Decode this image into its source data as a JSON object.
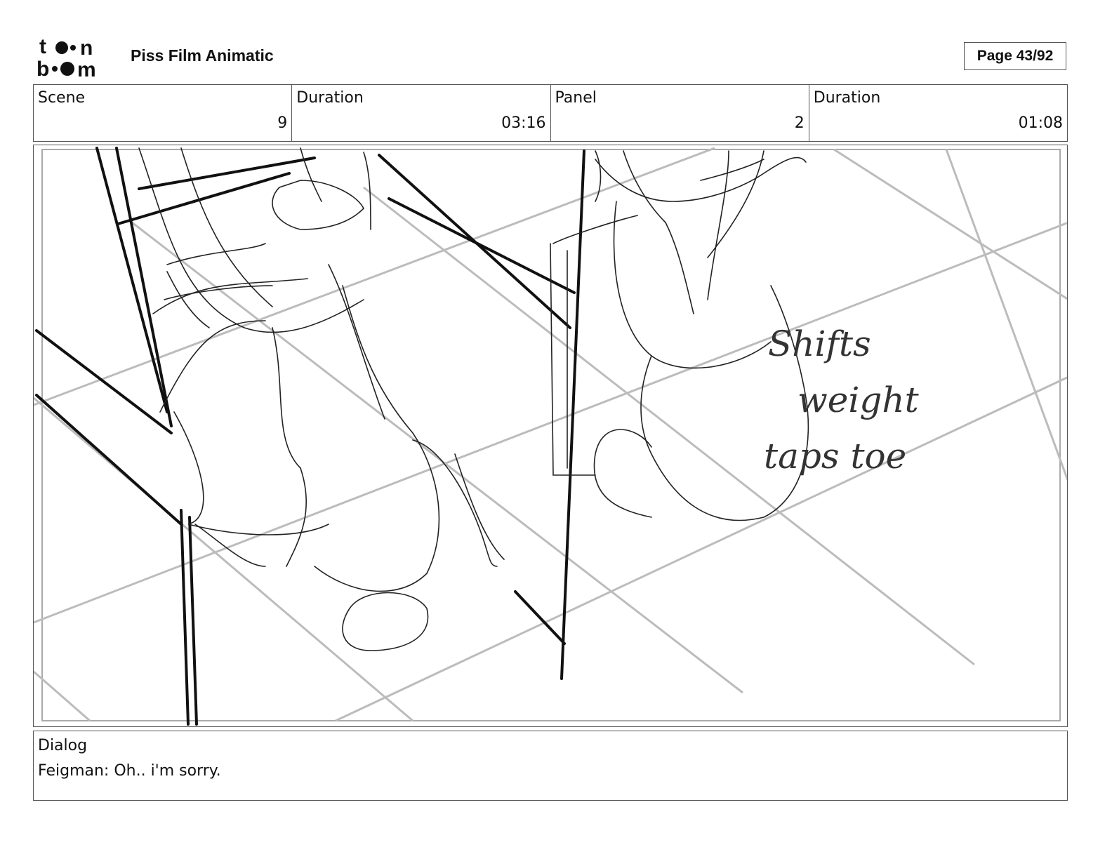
{
  "header": {
    "logo_text": "toon boom",
    "project_title": "Piss Film Animatic",
    "page_label": "Page 43/92"
  },
  "info": [
    {
      "label": "Scene",
      "value": "9"
    },
    {
      "label": "Duration",
      "value": "03:16"
    },
    {
      "label": "Panel",
      "value": "2"
    },
    {
      "label": "Duration",
      "value": "01:08"
    }
  ],
  "panel": {
    "handwritten_notes": [
      "Shifts",
      "weight",
      "taps toe"
    ]
  },
  "dialog": {
    "label": "Dialog",
    "text": "Feigman: Oh.. i'm sorry."
  }
}
